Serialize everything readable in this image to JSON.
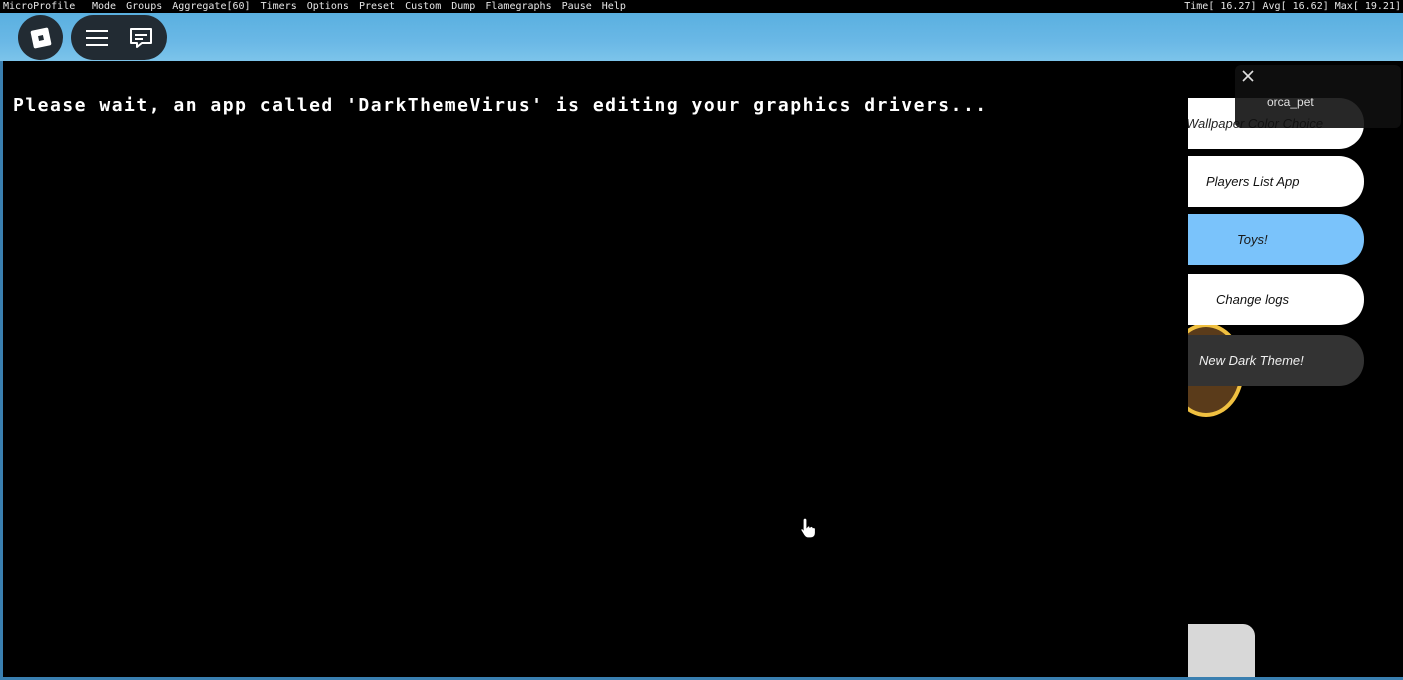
{
  "microprofile": {
    "title": "MicroProfile",
    "menu": [
      "Mode",
      "Groups",
      "Aggregate[60]",
      "Timers",
      "Options",
      "Preset",
      "Custom",
      "Dump",
      "Flamegraphs",
      "Pause",
      "Help"
    ],
    "stats": "Time[ 16.27] Avg[ 16.62] Max[ 19.21]"
  },
  "topbar": {
    "roblox_icon": "roblox-logo-icon",
    "menu_icon": "hamburger-menu-icon",
    "chat_icon": "chat-icon"
  },
  "main": {
    "message": "Please wait, an app called 'DarkThemeVirus' is editing your graphics drivers..."
  },
  "apps": [
    {
      "label": "Wallpaper Color Choice",
      "bg": "#ffffff",
      "fg": "#222222"
    },
    {
      "label": "Players List App",
      "bg": "#ffffff",
      "fg": "#111111"
    },
    {
      "label": "Toys!",
      "bg": "#7ac3fb",
      "fg": "#1a1a1a"
    },
    {
      "label": "Change logs",
      "bg": "#ffffff",
      "fg": "#111111"
    },
    {
      "label": "New Dark Theme!",
      "bg": "#333333",
      "fg": "#f0f0f0"
    }
  ],
  "notification": {
    "text": "orca_pet",
    "close_icon": "close-icon"
  }
}
